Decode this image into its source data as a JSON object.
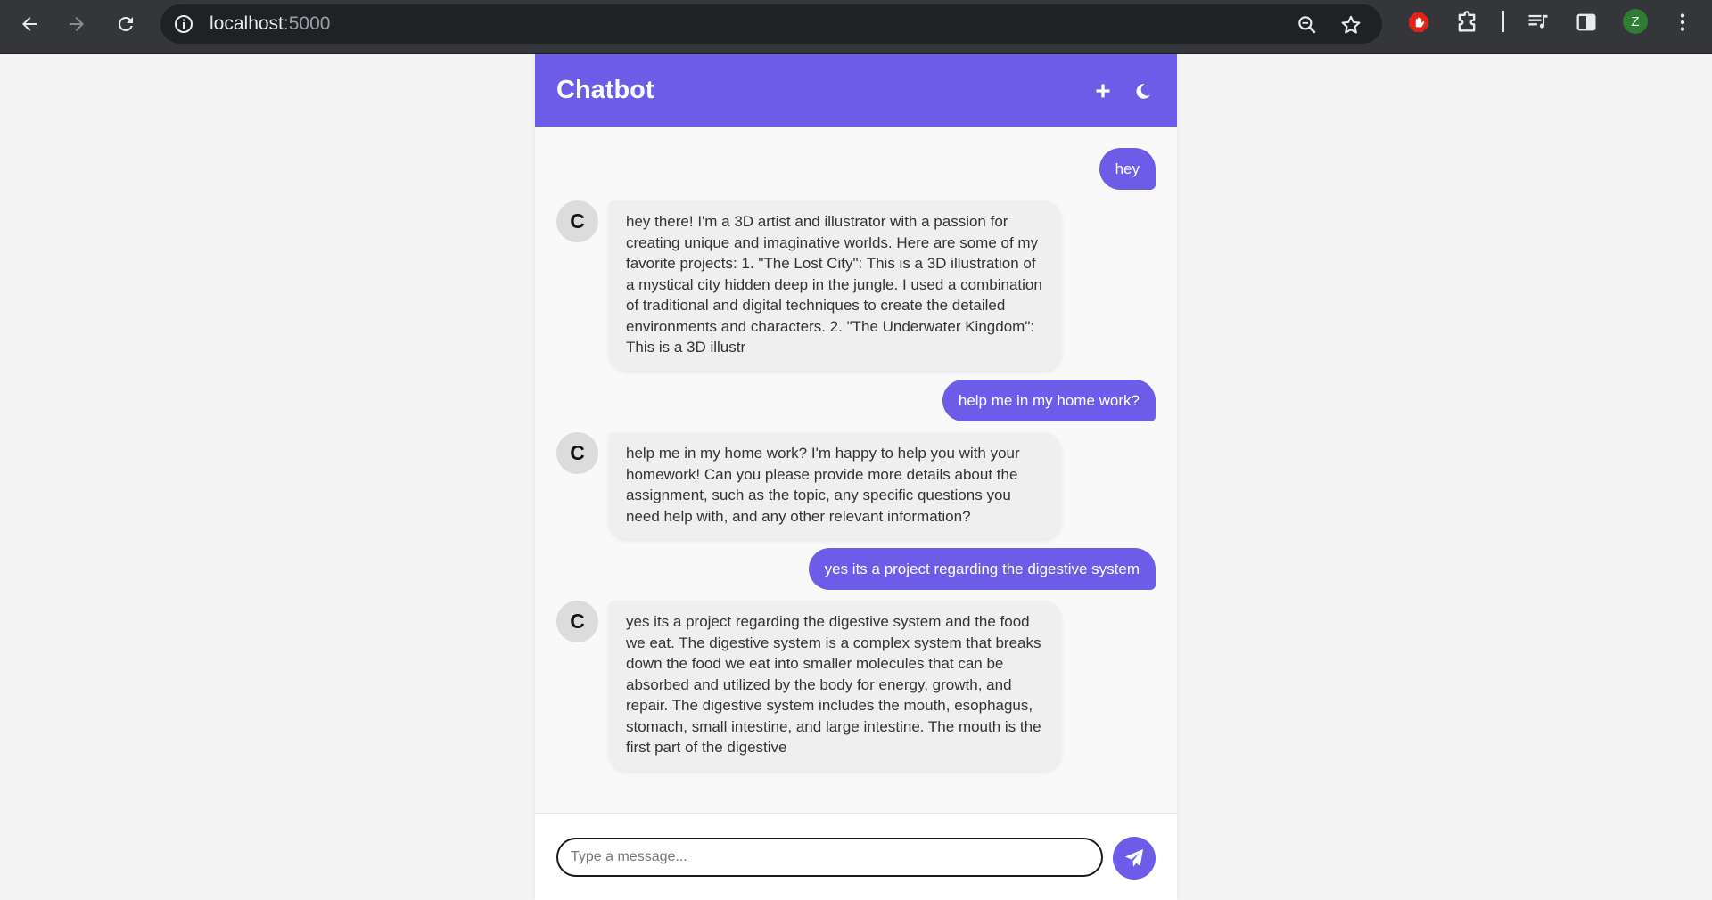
{
  "browser": {
    "url_host": "localhost",
    "url_port": ":5000",
    "profile_initial": "Z",
    "colors": {
      "bar": "#35363a",
      "omnibox": "#202124",
      "profile": "#2f7d32"
    }
  },
  "app": {
    "title": "Chatbot",
    "header_actions": [
      "plus-icon",
      "moon-icon"
    ],
    "accent": "#6c5ce7",
    "input_placeholder": "Type a message..."
  },
  "messages": [
    {
      "role": "user",
      "text": "hey"
    },
    {
      "role": "bot",
      "avatar": "C",
      "text": "hey there! I'm a 3D artist and illustrator with a passion for creating unique and imaginative worlds. Here are some of my favorite projects: 1. \"The Lost City\": This is a 3D illustration of a mystical city hidden deep in the jungle. I used a combination of traditional and digital techniques to create the detailed environments and characters. 2. \"The Underwater Kingdom\": This is a 3D illustr"
    },
    {
      "role": "user",
      "text": "help me in my home work?"
    },
    {
      "role": "bot",
      "avatar": "C",
      "text": "help me in my home work? I'm happy to help you with your homework! Can you please provide more details about the assignment, such as the topic, any specific questions you need help with, and any other relevant information?"
    },
    {
      "role": "user",
      "text": "yes its a project regarding the digestive system"
    },
    {
      "role": "bot",
      "avatar": "C",
      "text": "yes its a project regarding the digestive system and the food we eat. The digestive system is a complex system that breaks down the food we eat into smaller molecules that can be absorbed and utilized by the body for energy, growth, and repair. The digestive system includes the mouth, esophagus, stomach, small intestine, and large intestine. The mouth is the first part of the digestive"
    }
  ]
}
